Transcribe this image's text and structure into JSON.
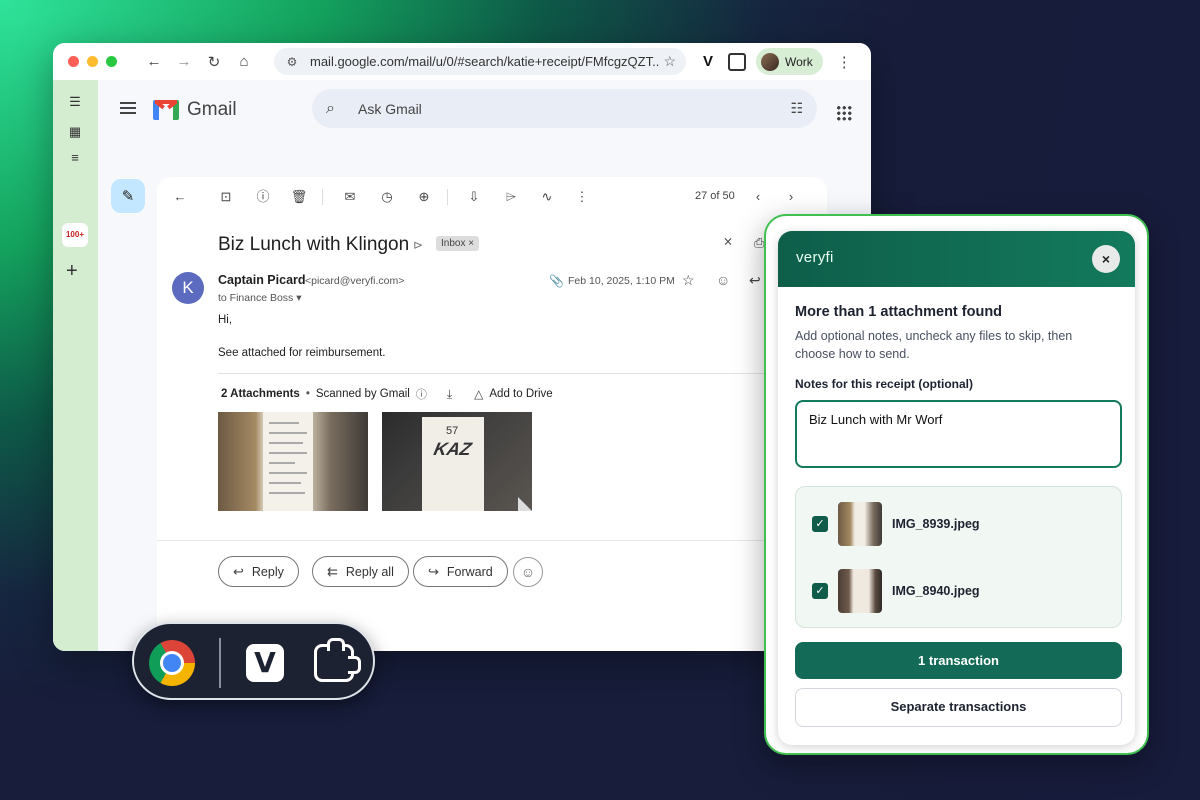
{
  "browser": {
    "url": "mail.google.com/mail/u/0/#search/katie+receipt/FMfcgzQZT...",
    "profile": "Work",
    "ext_letter": "V"
  },
  "gmail": {
    "wordmark": "Gmail",
    "search_placeholder": "Ask Gmail",
    "rail_badge": "100+",
    "pager": "27 of 50",
    "subject": "Biz Lunch with Klingon",
    "label_chip": "Inbox ×",
    "sender_initial": "K",
    "sender_name": "Captain Picard",
    "sender_email": "<picard@veryfi.com>",
    "to_line": "to Finance Boss ▾",
    "date": "Feb 10, 2025, 1:10 PM",
    "body_greeting": "Hi,",
    "body_line": "See attached for reimbursement.",
    "attachments_count": "2 Attachments",
    "attachments_dot": "•",
    "scanned_by": "Scanned by Gmail",
    "add_to_drive": "Add to Drive",
    "receipt_number": "57",
    "receipt_logo": "KAZ",
    "reply": "Reply",
    "reply_all": "Reply all",
    "forward": "Forward"
  },
  "pill": {
    "veryfi_letter": "V"
  },
  "veryfi": {
    "brand": "veryfi",
    "close": "×",
    "title": "More than 1 attachment found",
    "description": "Add optional notes, uncheck any files to skip, then choose how to send.",
    "notes_label": "Notes for this receipt (optional)",
    "notes_value": "Biz Lunch with Mr Worf",
    "files": [
      {
        "name": "IMG_8939.jpeg",
        "checked": true
      },
      {
        "name": "IMG_8940.jpeg",
        "checked": true
      }
    ],
    "check_mark": "✓",
    "primary_button": "1 transaction",
    "secondary_button": "Separate transactions"
  },
  "colors": {
    "veryfi_green": "#136b57",
    "panel_border": "#3fc050",
    "rail_green": "#d4ecd0"
  },
  "icons": [
    "search-icon",
    "tune-icon",
    "apps-icon",
    "compose-icon",
    "back-icon",
    "archive-icon",
    "report-icon",
    "trash-icon",
    "mark-unread-icon",
    "snooze-icon",
    "add-task-icon",
    "move-icon",
    "label-icon",
    "filter-icon",
    "more-icon",
    "prev-icon",
    "next-icon",
    "star-icon",
    "emoji-icon",
    "reply-icon",
    "print-icon",
    "popout-icon",
    "download-icon",
    "drive-icon",
    "info-icon",
    "chrome-icon",
    "extensions-icon",
    "close-icon",
    "checkbox-icon"
  ]
}
